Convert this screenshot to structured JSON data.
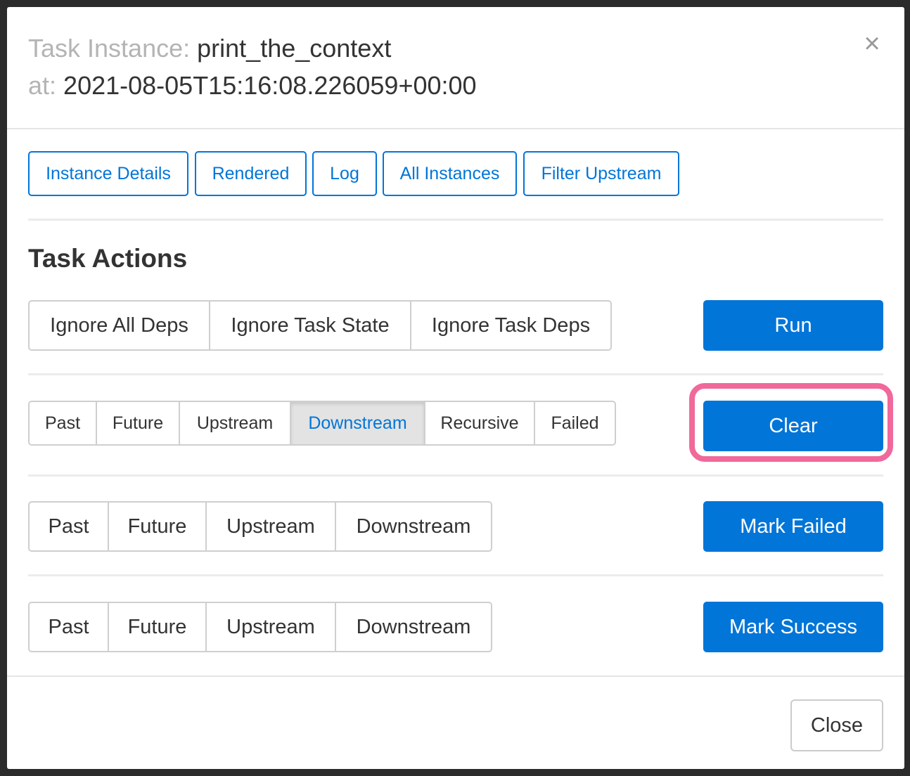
{
  "header": {
    "task_label": "Task Instance:",
    "task_name": "print_the_context",
    "at_label": "at:",
    "execution_date": "2021-08-05T15:16:08.226059+00:00",
    "close_icon": "×"
  },
  "nav_buttons": [
    "Instance Details",
    "Rendered",
    "Log",
    "All Instances",
    "Filter Upstream"
  ],
  "task_actions": {
    "title": "Task Actions",
    "run": {
      "options": [
        "Ignore All Deps",
        "Ignore Task State",
        "Ignore Task Deps"
      ],
      "button": "Run"
    },
    "clear": {
      "options": [
        "Past",
        "Future",
        "Upstream",
        "Downstream",
        "Recursive",
        "Failed"
      ],
      "active_option": "Downstream",
      "button": "Clear"
    },
    "mark_failed": {
      "options": [
        "Past",
        "Future",
        "Upstream",
        "Downstream"
      ],
      "button": "Mark Failed"
    },
    "mark_success": {
      "options": [
        "Past",
        "Future",
        "Upstream",
        "Downstream"
      ],
      "button": "Mark Success"
    }
  },
  "footer": {
    "close_label": "Close"
  },
  "colors": {
    "primary": "#0275d8",
    "highlight": "#f0699a",
    "muted_text": "#b4b4b4",
    "active_option_bg": "#e3e3e3"
  }
}
